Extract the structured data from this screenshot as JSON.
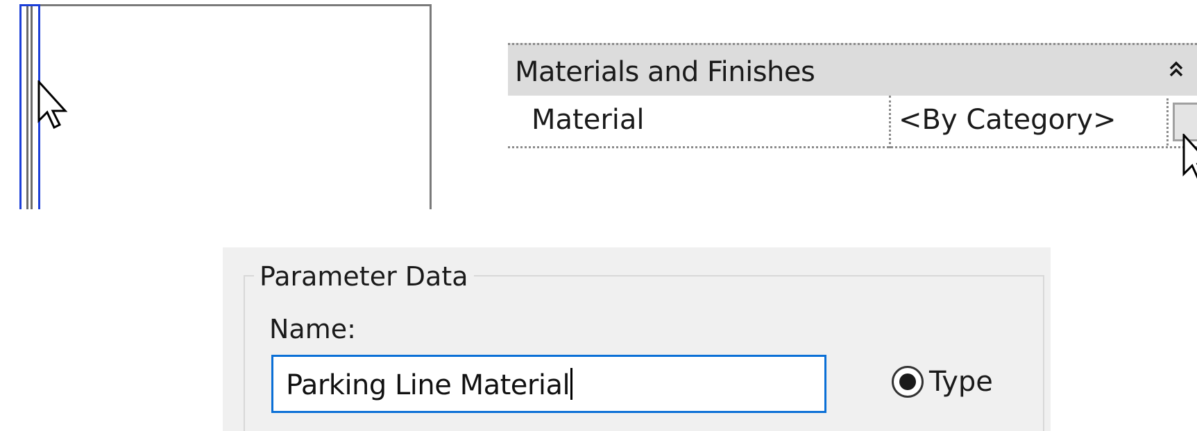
{
  "properties": {
    "group_label": "Materials and Finishes",
    "row": {
      "name": "Material",
      "value": "<By Category>"
    }
  },
  "parameter_dialog": {
    "group_title": "Parameter Data",
    "name_label": "Name:",
    "name_value": "Parking Line Material",
    "radio_type_label": "Type",
    "radio_type_selected": true
  },
  "colors": {
    "selection_blue": "#1c3fd8",
    "input_focus_blue": "#0a6fd6",
    "group_header_gray": "#dcdcdc",
    "dialog_bg": "#f0f0f0"
  },
  "icons": [
    "mouse-pointer-icon",
    "collapse-chevrons-icon"
  ]
}
